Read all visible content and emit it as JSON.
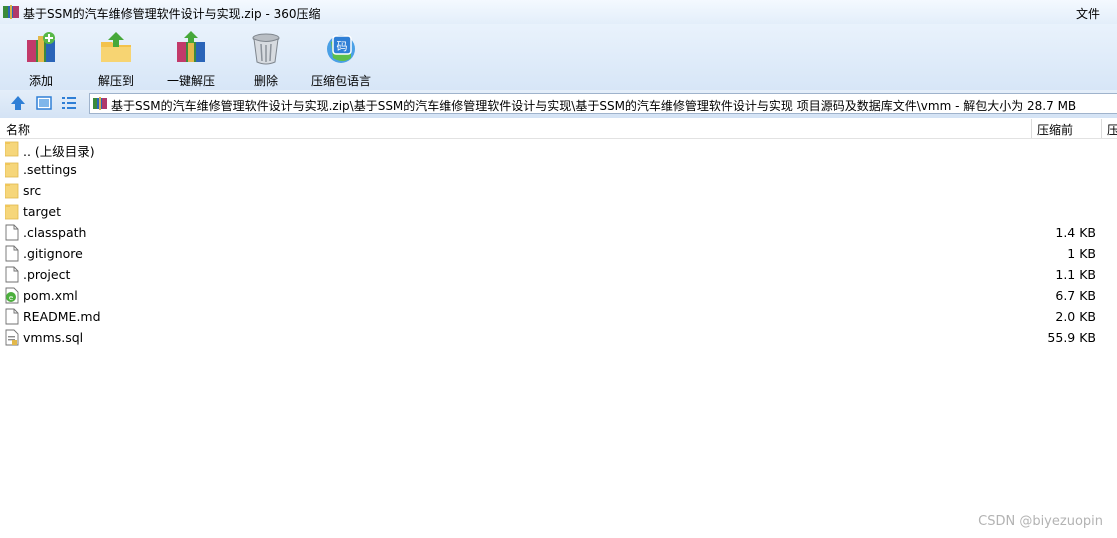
{
  "window": {
    "title": "基于SSM的汽车维修管理软件设计与实现.zip - 360压缩",
    "menu_file": "文件"
  },
  "toolbar": {
    "buttons": [
      {
        "label": "添加",
        "icon": "add-archive-icon"
      },
      {
        "label": "解压到",
        "icon": "extract-to-icon"
      },
      {
        "label": "一键解压",
        "icon": "one-click-extract-icon"
      },
      {
        "label": "删除",
        "icon": "delete-trash-icon"
      },
      {
        "label": "压缩包语言",
        "icon": "archive-language-icon"
      }
    ]
  },
  "address": {
    "path": "基于SSM的汽车维修管理软件设计与实现.zip\\基于SSM的汽车维修管理软件设计与实现\\基于SSM的汽车维修管理软件设计与实现 项目源码及数据库文件\\vmm - 解包大小为 28.7 MB"
  },
  "columns": {
    "name": "名称",
    "size": "压缩前",
    "next": "压"
  },
  "files": [
    {
      "name": ".. (上级目录)",
      "size": "",
      "icon": "folder-icon"
    },
    {
      "name": ".settings",
      "size": "",
      "icon": "folder-icon"
    },
    {
      "name": "src",
      "size": "",
      "icon": "folder-icon"
    },
    {
      "name": "target",
      "size": "",
      "icon": "folder-icon"
    },
    {
      "name": ".classpath",
      "size": "1.4 KB",
      "icon": "file-icon"
    },
    {
      "name": ".gitignore",
      "size": "1 KB",
      "icon": "file-icon"
    },
    {
      "name": ".project",
      "size": "1.1 KB",
      "icon": "file-icon"
    },
    {
      "name": "pom.xml",
      "size": "6.7 KB",
      "icon": "xml-file-icon"
    },
    {
      "name": "README.md",
      "size": "2.0 KB",
      "icon": "file-icon"
    },
    {
      "name": "vmms.sql",
      "size": "55.9 KB",
      "icon": "sql-file-icon"
    }
  ],
  "watermark": "CSDN @biyezuopin",
  "colors": {
    "folder": "#f6d67a",
    "toolbar_bg": "#dde9f7",
    "accent_blue": "#2f7fd6"
  }
}
